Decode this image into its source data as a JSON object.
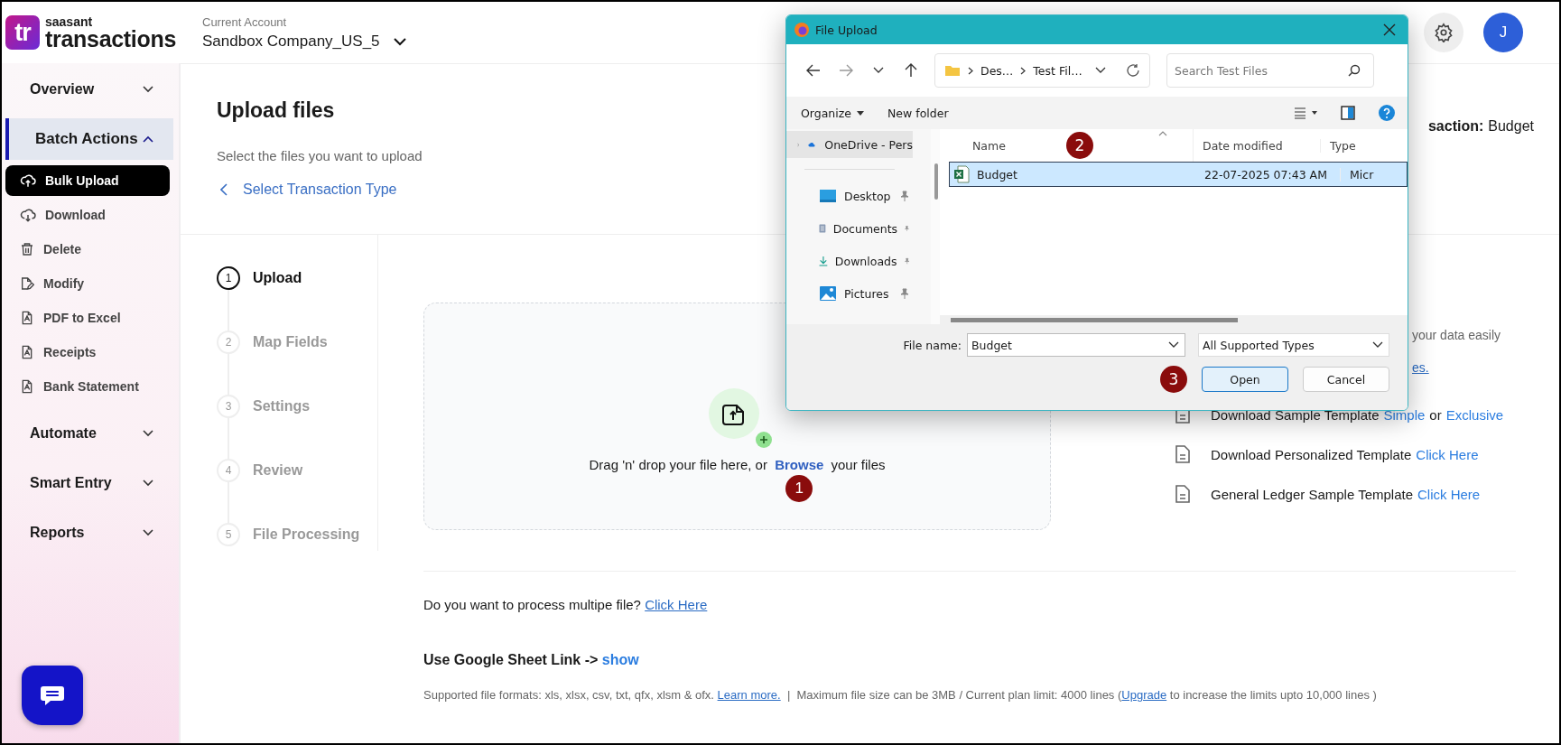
{
  "app": {
    "logo_mark": "tr",
    "logo_top": "saasant",
    "logo_bottom": "transactions"
  },
  "account": {
    "label": "Current Account",
    "value": "Sandbox Company_US_5"
  },
  "avatar": "J",
  "sidebar": {
    "items": [
      {
        "kind": "section",
        "label": "Overview",
        "expanded": false,
        "selected": false
      },
      {
        "kind": "section",
        "label": "Batch Actions",
        "expanded": true,
        "selected": true
      },
      {
        "kind": "item",
        "label": "Bulk Upload",
        "selected": true
      },
      {
        "kind": "item",
        "label": "Download",
        "selected": false
      },
      {
        "kind": "item",
        "label": "Delete",
        "selected": false
      },
      {
        "kind": "item",
        "label": "Modify",
        "selected": false
      },
      {
        "kind": "item",
        "label": "PDF to Excel",
        "selected": false
      },
      {
        "kind": "item",
        "label": "Receipts",
        "selected": false
      },
      {
        "kind": "item",
        "label": "Bank Statement",
        "selected": false
      },
      {
        "kind": "section",
        "label": "Automate",
        "expanded": false,
        "selected": false
      },
      {
        "kind": "section",
        "label": "Smart Entry",
        "expanded": false,
        "selected": false
      },
      {
        "kind": "section",
        "label": "Reports",
        "expanded": false,
        "selected": false
      }
    ]
  },
  "page": {
    "title": "Upload files",
    "subtitle": "Select the files you want to upload",
    "back_link": "Select Transaction Type",
    "transaction_label": "saction:",
    "transaction_value": "Budget"
  },
  "steps": [
    {
      "number": "1",
      "label": "Upload",
      "selected": true
    },
    {
      "number": "2",
      "label": "Map Fields",
      "selected": false
    },
    {
      "number": "3",
      "label": "Settings",
      "selected": false
    },
    {
      "number": "4",
      "label": "Review",
      "selected": false
    },
    {
      "number": "5",
      "label": "File Processing",
      "selected": false
    }
  ],
  "dropzone": {
    "text_before": "Drag 'n' drop your file here, or",
    "link": "Browse",
    "text_after": "your files",
    "marker": "1"
  },
  "right_panel": {
    "note": "your data easily",
    "note_link": "es.",
    "templates": [
      {
        "text": "Download Sample Template",
        "links": [
          "Simple",
          "Exclusive"
        ],
        "joiner": "or"
      },
      {
        "text": "Download Personalized Template",
        "links": [
          "Click Here"
        ]
      },
      {
        "text": "General Ledger Sample Template",
        "links": [
          "Click Here"
        ]
      }
    ]
  },
  "multi": {
    "question": "Do you want to process multipe file?",
    "link": "Click Here"
  },
  "google": {
    "label": "Use Google Sheet Link ->",
    "link": "show"
  },
  "footer": {
    "formats": "Supported file formats: xls, xlsx, csv, txt, qfx, xlsm & ofx.",
    "learn": "Learn more.",
    "separator": "|",
    "limit": "Maximum file size can be 3MB / Current plan limit: 4000 lines (",
    "upgrade": "Upgrade",
    "rest": "to increase the limits upto 10,000 lines )"
  },
  "dialog": {
    "title": "File Upload",
    "path": [
      "Des…",
      "Test Fil…"
    ],
    "search_placeholder": "Search Test Files",
    "organize": "Organize",
    "new_folder": "New folder",
    "nav": [
      {
        "kind": "cloud",
        "label": "OneDrive - Pers",
        "selected": true
      },
      {
        "kind": "desktop",
        "label": "Desktop",
        "selected": false
      },
      {
        "kind": "documents",
        "label": "Documents",
        "selected": false
      },
      {
        "kind": "downloads",
        "label": "Downloads",
        "selected": false
      },
      {
        "kind": "pictures",
        "label": "Pictures",
        "selected": false
      }
    ],
    "columns": [
      "Name",
      "Date modified",
      "Type"
    ],
    "columns_marker": "2",
    "files": [
      {
        "name": "Budget",
        "date": "22-07-2025 07:43 AM",
        "type": "Micr",
        "selected": true
      }
    ],
    "file_name_label": "File name:",
    "file_name": "Budget",
    "file_type": "All Supported Types",
    "open": "Open",
    "open_marker": "3",
    "cancel": "Cancel"
  }
}
